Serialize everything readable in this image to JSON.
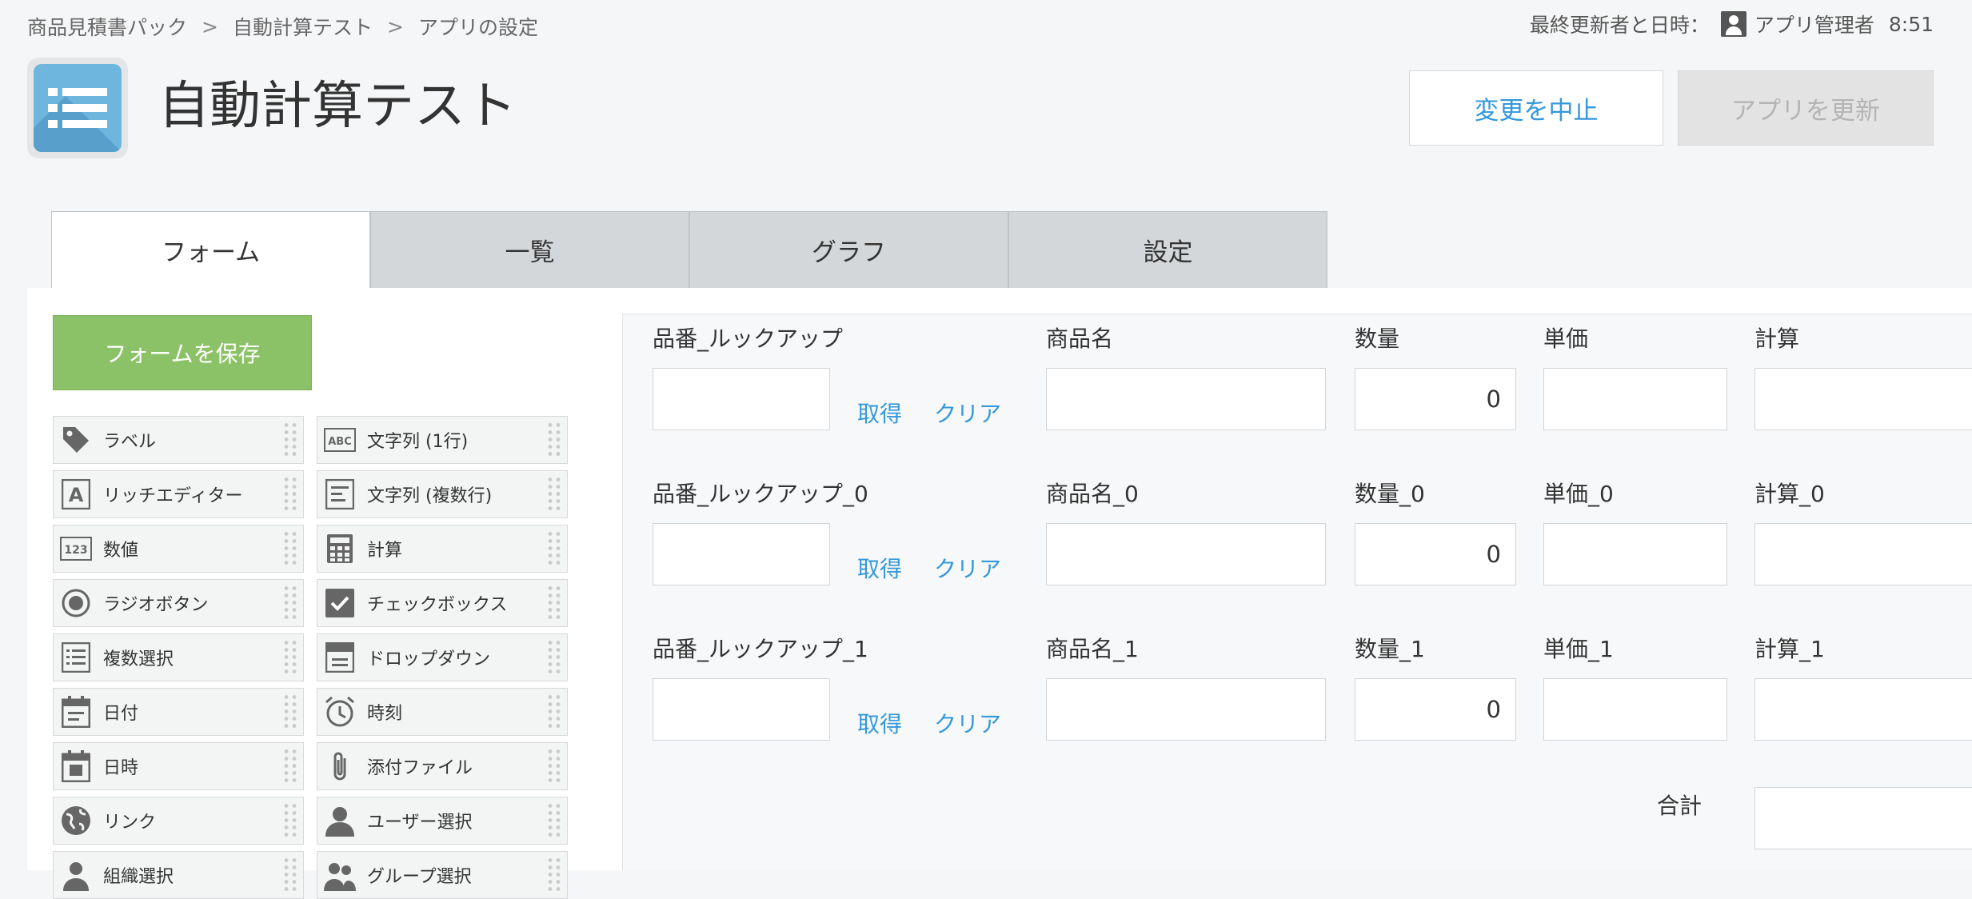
{
  "breadcrumb": [
    "商品見積書パック",
    "自動計算テスト",
    "アプリの設定"
  ],
  "updated": {
    "label": "最終更新者と日時：",
    "user": "アプリ管理者",
    "time": "8:51"
  },
  "app": {
    "title": "自動計算テスト",
    "icon": "list-icon",
    "icon_color": "#6fb6df"
  },
  "header_buttons": {
    "cancel": "変更を中止",
    "update": "アプリを更新"
  },
  "tabs": [
    "フォーム",
    "一覧",
    "グラフ",
    "設定"
  ],
  "save_button": "フォームを保存",
  "colors": {
    "link": "#3498db",
    "save": "#8cc267",
    "tab_inactive": "#d4d7d9"
  },
  "palette": [
    {
      "label": "ラベル",
      "icon": "tag-icon"
    },
    {
      "label": "文字列 (1行)",
      "icon": "abc-icon"
    },
    {
      "label": "リッチエディター",
      "icon": "rich-editor-icon"
    },
    {
      "label": "文字列 (複数行)",
      "icon": "multiline-text-icon"
    },
    {
      "label": "数値",
      "icon": "number-123-icon"
    },
    {
      "label": "計算",
      "icon": "calculator-icon"
    },
    {
      "label": "ラジオボタン",
      "icon": "radio-icon"
    },
    {
      "label": "チェックボックス",
      "icon": "checkbox-icon"
    },
    {
      "label": "複数選択",
      "icon": "multi-select-icon"
    },
    {
      "label": "ドロップダウン",
      "icon": "dropdown-icon"
    },
    {
      "label": "日付",
      "icon": "calendar-icon"
    },
    {
      "label": "時刻",
      "icon": "clock-icon"
    },
    {
      "label": "日時",
      "icon": "datetime-icon"
    },
    {
      "label": "添付ファイル",
      "icon": "paperclip-icon"
    },
    {
      "label": "リンク",
      "icon": "globe-icon"
    },
    {
      "label": "ユーザー選択",
      "icon": "user-icon"
    },
    {
      "label": "組織選択",
      "icon": "org-icon"
    },
    {
      "label": "グループ選択",
      "icon": "group-icon"
    }
  ],
  "form": {
    "rows": [
      {
        "lookup": "品番_ルックアップ",
        "name": "商品名",
        "qty": "数量",
        "qty_value": "0",
        "price": "単価",
        "calc": "計算"
      },
      {
        "lookup": "品番_ルックアップ_0",
        "name": "商品名_0",
        "qty": "数量_0",
        "qty_value": "0",
        "price": "単価_0",
        "calc": "計算_0"
      },
      {
        "lookup": "品番_ルックアップ_1",
        "name": "商品名_1",
        "qty": "数量_1",
        "qty_value": "0",
        "price": "単価_1",
        "calc": "計算_1"
      }
    ],
    "fetch": "取得",
    "clear": "クリア",
    "total_label": "合計"
  }
}
